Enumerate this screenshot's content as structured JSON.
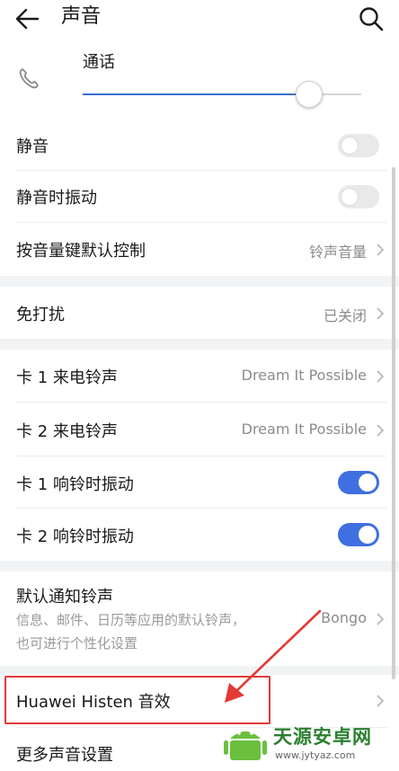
{
  "header": {
    "title": "声音"
  },
  "call_volume": {
    "label": "通话",
    "level": 0.81
  },
  "rows": {
    "mute": {
      "label": "静音",
      "on": false
    },
    "mute_vibrate": {
      "label": "静音时振动",
      "on": false
    },
    "volume_key": {
      "label": "按音量键默认控制",
      "value": "铃声音量"
    },
    "dnd": {
      "label": "免打扰",
      "value": "已关闭"
    },
    "sim1_ring": {
      "label": "卡 1 来电铃声",
      "value": "Dream It Possible"
    },
    "sim2_ring": {
      "label": "卡 2 来电铃声",
      "value": "Dream It Possible"
    },
    "sim1_vibrate": {
      "label": "卡 1 响铃时振动",
      "on": true
    },
    "sim2_vibrate": {
      "label": "卡 2 响铃时振动",
      "on": true
    },
    "notif": {
      "label": "默认通知铃声",
      "desc_line1": "信息、邮件、日历等应用的默认铃声，",
      "desc_line2": "也可进行个性化设置",
      "value": "Bongo"
    },
    "histen": {
      "label": "Huawei Histen 音效"
    },
    "more": {
      "label": "更多声音设置"
    }
  },
  "watermark": {
    "text": "天源安卓网",
    "url": "www.jytyaz.com"
  },
  "colors": {
    "accent": "#3f6fe0",
    "annotation": "#e33a36"
  }
}
